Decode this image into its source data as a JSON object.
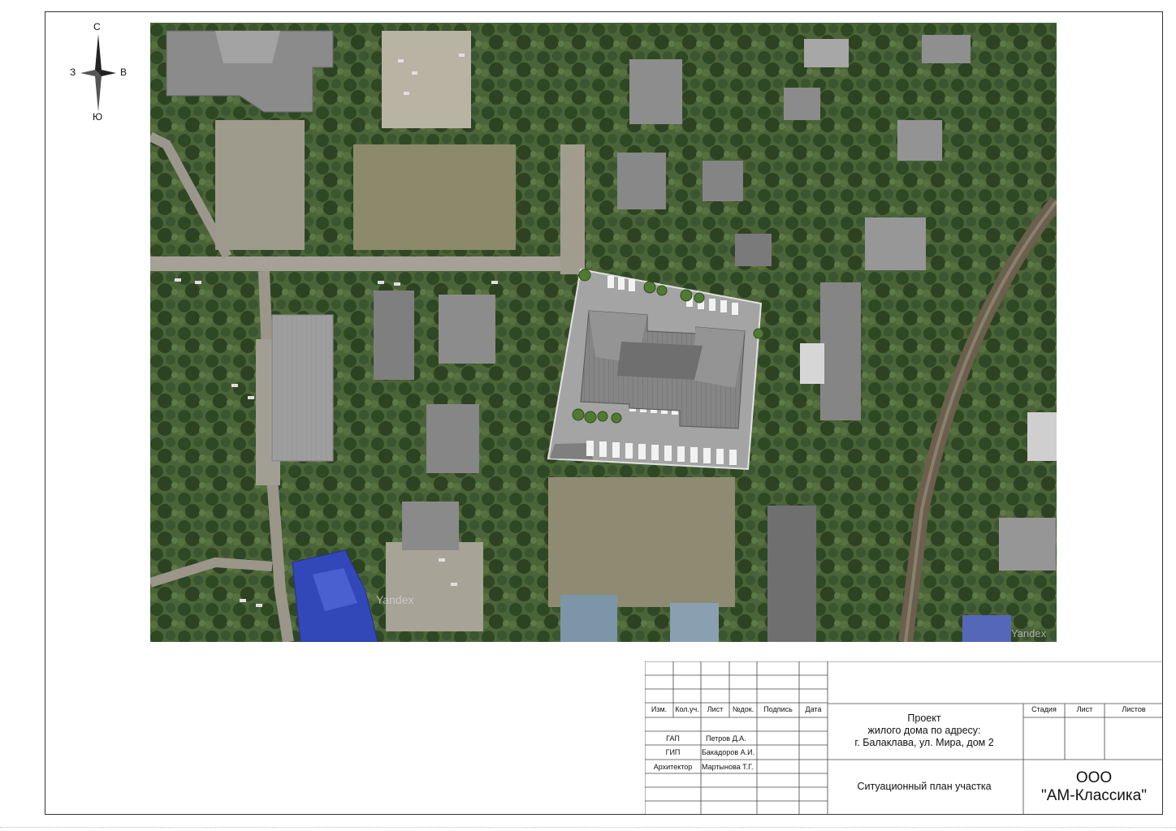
{
  "compass": {
    "north": "С",
    "south": "Ю",
    "west": "З",
    "east": "В"
  },
  "map": {
    "watermark": "Yandex",
    "watermark_2": "Yandex"
  },
  "stamp": {
    "headers": [
      "Изм.",
      "Кол.уч.",
      "Лист",
      "№док.",
      "Подпись",
      "Дата"
    ],
    "roles": [
      {
        "role": "ГАП",
        "name": "Петров Д.А."
      },
      {
        "role": "ГИП",
        "name": "Бакадоров А.И."
      },
      {
        "role": "Архитектор",
        "name": "Мартынова Т.Г."
      }
    ],
    "project_lines": [
      "Проект",
      "жилого дома по адресу:",
      "г. Балаклава, ул. Мира, дом 2"
    ],
    "sheet_title": "Ситуационный план участка",
    "right_headers": [
      "Стадия",
      "Лист",
      "Листов"
    ],
    "org_line1": "ООО",
    "org_line2": "\"АМ-Классика\""
  },
  "colors": {
    "vegetation": "#3f5a2e",
    "project_site": "#9a9a9a",
    "roof": "#7d7d7d",
    "blue_roof": "#3348b8",
    "railway": "#6b5f4e"
  }
}
